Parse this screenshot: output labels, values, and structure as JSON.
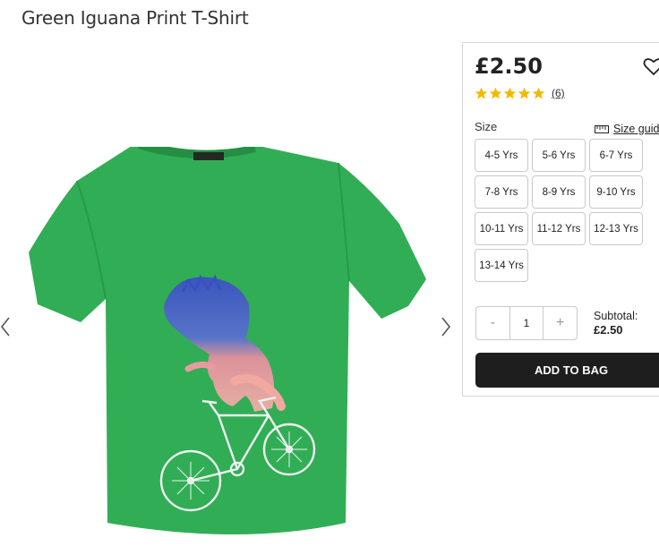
{
  "product": {
    "title": "Green Iguana Print T-Shirt"
  },
  "gallery": {
    "prev_icon": "chevron-left-icon",
    "next_icon": "chevron-right-icon"
  },
  "panel": {
    "price": "£2.50",
    "rating": {
      "stars": 5,
      "max": 5,
      "count_label": "(6)"
    },
    "size_label": "Size",
    "size_guide_label": "Size guide",
    "sizes": [
      "4-5 Yrs",
      "5-6 Yrs",
      "6-7 Yrs",
      "7-8 Yrs",
      "8-9 Yrs",
      "9-10 Yrs",
      "10-11 Yrs",
      "11-12 Yrs",
      "12-13 Yrs",
      "13-14 Yrs"
    ],
    "quantity": {
      "minus": "-",
      "value": "1",
      "plus": "+"
    },
    "subtotal_label": "Subtotal:",
    "subtotal_value": "£2.50",
    "add_to_bag": "ADD TO BAG"
  },
  "colors": {
    "shirt": "#2fad55",
    "button": "#1e1e1e",
    "star": "#f5b800"
  }
}
